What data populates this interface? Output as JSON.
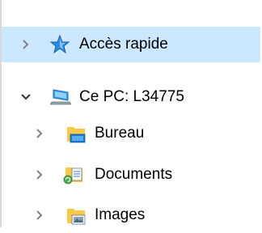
{
  "tree": {
    "quick_access": {
      "label": "Accès rapide",
      "icon": "blue-star-pin-icon",
      "expanded": false,
      "selected": true
    },
    "this_pc": {
      "label": "Ce PC: L34775",
      "icon": "computer-monitor-icon",
      "expanded": true,
      "children": [
        {
          "label": "Bureau",
          "icon": "desktop-folder-icon"
        },
        {
          "label": "Documents",
          "icon": "documents-folder-icon"
        },
        {
          "label": "Images",
          "icon": "pictures-folder-icon"
        }
      ]
    }
  },
  "colors": {
    "selection": "#cce8ff",
    "chevron": "#808080",
    "folder": "#f7c948",
    "accent": "#0078d7"
  }
}
